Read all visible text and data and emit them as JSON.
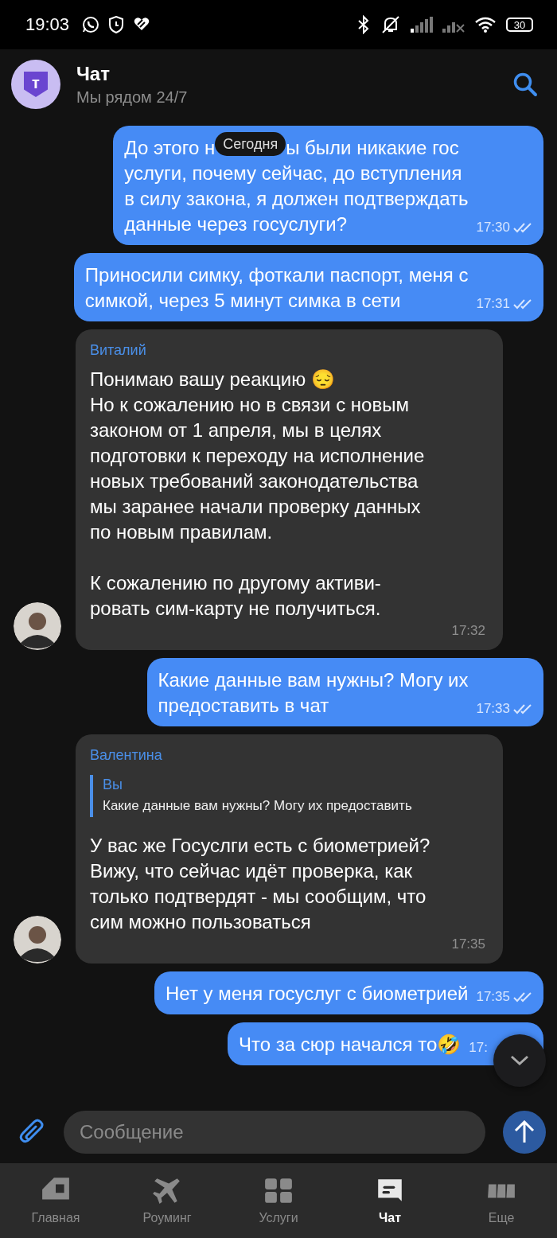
{
  "status_bar": {
    "time": "19:03",
    "battery": "30"
  },
  "header": {
    "logo_text": "т",
    "title": "Чат",
    "subtitle": "Мы рядом 24/7"
  },
  "date_label": "Сегодня",
  "messages": [
    {
      "kind": "outgoing",
      "lead": {
        "before": "До этого н",
        "after": "ы были никакие гос"
      },
      "text": "услуги, почему сейчас, до вступления\nв силу закона, я должен подтверждать\nданные через госуслуги?",
      "time": "17:30",
      "read": true
    },
    {
      "kind": "outgoing",
      "text": "Приносили симку, фоткали паспорт, меня с\nсимкой, через 5 минут симка в сети",
      "time": "17:31",
      "read": true
    },
    {
      "kind": "incoming",
      "sender": "Виталий",
      "text": "Понимаю вашу реакцию 😔\nНо к сожалению но в связи с новым\nзаконом от 1 апреля, мы в целях\nподготовки к переходу на исполнение\nновых требований законодательства\nмы заранее начали проверку данных\nпо новым правилам.\n\nК сожалению по другому активи-\nровать сим-карту не получиться.",
      "time": "17:32"
    },
    {
      "kind": "outgoing",
      "text": "Какие данные вам нужны? Могу их\nпредоставить в чат",
      "time": "17:33",
      "read": true
    },
    {
      "kind": "incoming",
      "sender": "Валентина",
      "reply": {
        "author": "Вы",
        "text": "Какие данные вам нужны? Могу их предоставить"
      },
      "text": "У вас же Госуслги есть с биометрией?\nВижу, что сейчас идёт проверка, как\nтолько подтвердят - мы сообщим, что\nсим можно пользоваться",
      "time": "17:35"
    },
    {
      "kind": "outgoing",
      "text": "Нет у меня госуслуг с биометрией",
      "time": "17:35",
      "read": true
    },
    {
      "kind": "outgoing",
      "text": "Что за сюр начался то🤣",
      "time": "17:"
    }
  ],
  "composer": {
    "placeholder": "Сообщение"
  },
  "nav": [
    {
      "label": "Главная",
      "selected": false
    },
    {
      "label": "Роуминг",
      "selected": false
    },
    {
      "label": "Услуги",
      "selected": false
    },
    {
      "label": "Чат",
      "selected": true
    },
    {
      "label": "Еще",
      "selected": false
    }
  ]
}
